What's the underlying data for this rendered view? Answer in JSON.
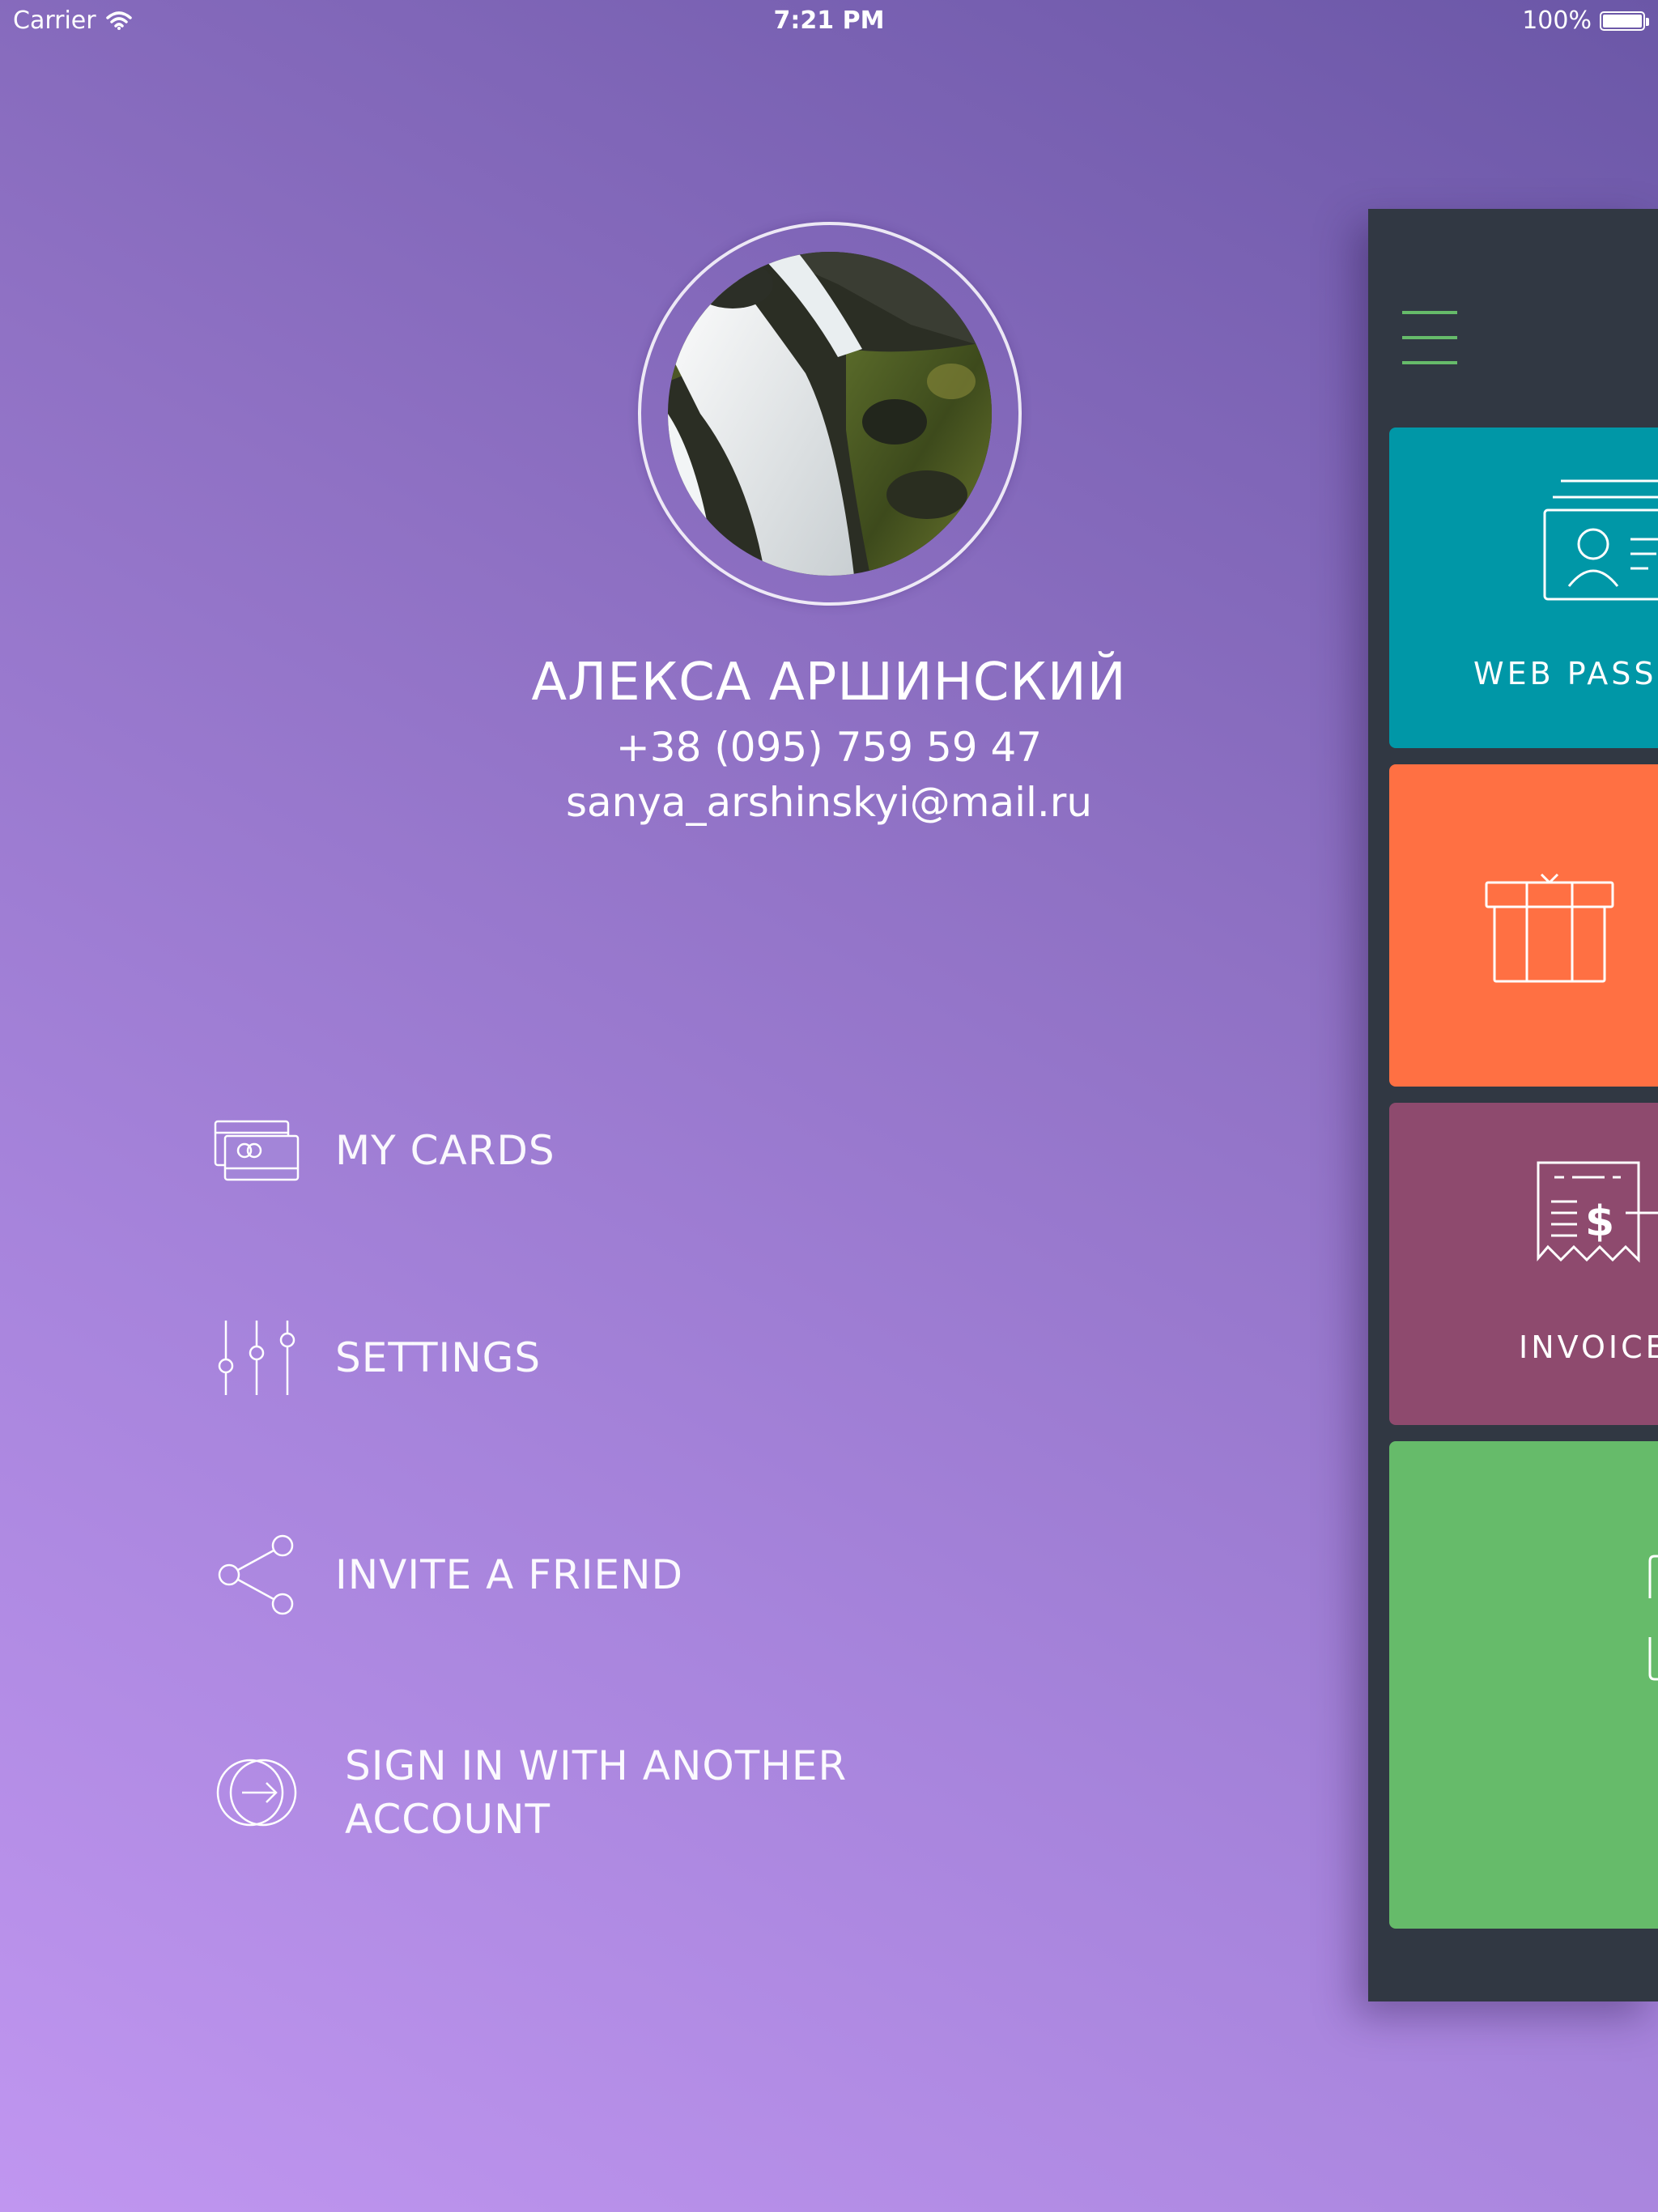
{
  "status_bar": {
    "carrier": "Carrier",
    "time": "7:21 PM",
    "battery": "100%",
    "battery_level_percent": 100
  },
  "profile": {
    "name": "АЛЕКСА АРШИНСКИЙ",
    "phone": "+38 (095) 759 59 47",
    "email": "sanya_arshinskyi@mail.ru"
  },
  "menu": {
    "items": [
      {
        "label": "MY CARDS",
        "icon": "cards-icon"
      },
      {
        "label": "SETTINGS",
        "icon": "sliders-icon"
      },
      {
        "label": "INVITE A FRIEND",
        "icon": "share-icon"
      },
      {
        "label_line1": "SIGN IN WITH ANOTHER",
        "label_line2": "ACCOUNT",
        "icon": "sign-in-icon"
      }
    ]
  },
  "main_panel": {
    "menu_icon": "hamburger-menu-icon",
    "tiles": [
      {
        "label": "WEB PASSP",
        "color": "#0097a7",
        "icon": "id-card-icon"
      },
      {
        "label": "",
        "color": "#ff7043",
        "icon": "gift-icon"
      },
      {
        "label": "INVOICE",
        "color": "#8e4a6e",
        "icon": "invoice-icon"
      },
      {
        "label": "",
        "color": "#66bb6a",
        "icon": "document-icon"
      }
    ]
  },
  "colors": {
    "background_gradient_light": "#c096f0",
    "background_gradient_dark": "#6b57a7",
    "panel_background": "#313843",
    "accent_green": "#66bb6a"
  }
}
